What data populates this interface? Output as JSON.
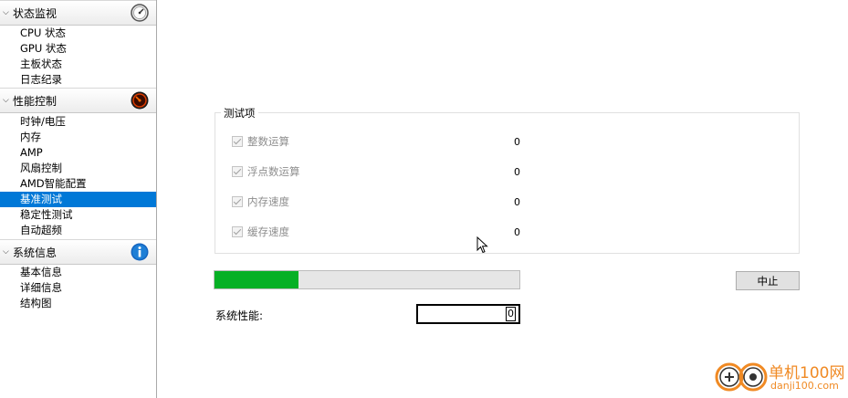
{
  "sidebar": {
    "groups": [
      {
        "title": "状态监视",
        "icon": "gauge-icon",
        "items": [
          "CPU 状态",
          "GPU 状态",
          "主板状态",
          "日志纪录"
        ]
      },
      {
        "title": "性能控制",
        "icon": "performance-dial-icon",
        "items": [
          "时钟/电压",
          "内存",
          "AMP",
          "风扇控制",
          "AMD智能配置",
          "基准测试",
          "稳定性测试",
          "自动超频"
        ]
      },
      {
        "title": "系统信息",
        "icon": "info-icon",
        "items": [
          "基本信息",
          "详细信息",
          "结构图"
        ]
      }
    ],
    "active_item": "基准测试"
  },
  "test_items": {
    "title": "测试项",
    "rows": [
      {
        "label": "整数运算",
        "value": "0",
        "checked": true
      },
      {
        "label": "浮点数运算",
        "value": "0",
        "checked": true
      },
      {
        "label": "内存速度",
        "value": "0",
        "checked": true
      },
      {
        "label": "缓存速度",
        "value": "0",
        "checked": true
      }
    ]
  },
  "progress": {
    "fraction": 0.275,
    "color": "#06b025"
  },
  "stop_button": {
    "label": "中止"
  },
  "performance": {
    "label": "系统性能:",
    "value": "0"
  },
  "watermark": {
    "name": "单机100网",
    "url": "danji100.com"
  },
  "colors": {
    "accent": "#0078d7",
    "progress": "#06b025",
    "watermark": "#f08a24"
  }
}
